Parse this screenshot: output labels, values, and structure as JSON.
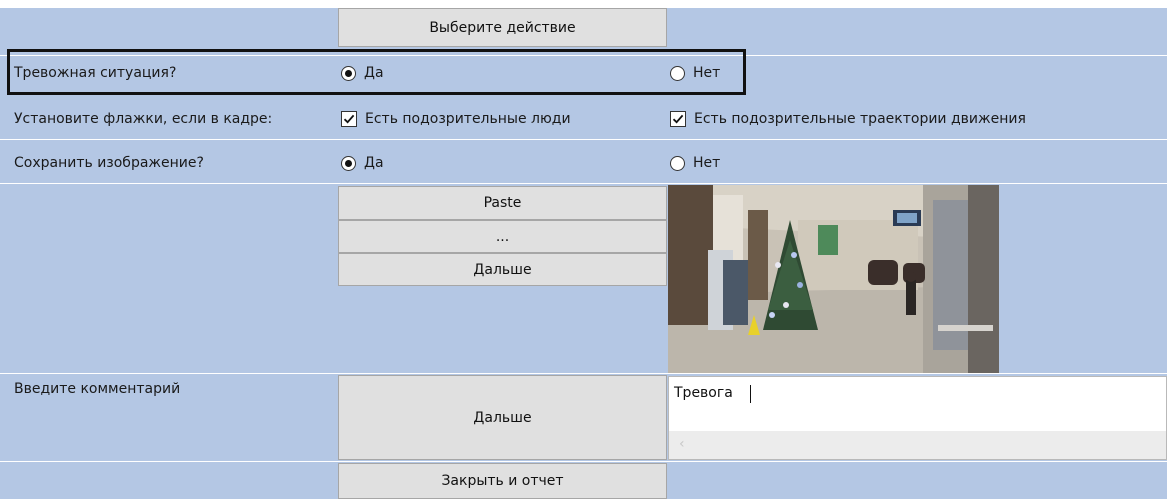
{
  "form": {
    "select_action_label": "Выберите действие",
    "q_alarm": {
      "label": "Тревожная ситуация?",
      "options": [
        {
          "label": "Да",
          "checked": true
        },
        {
          "label": "Нет",
          "checked": false
        }
      ]
    },
    "q_flags": {
      "label": "Установите флажки, если в кадре:",
      "options": [
        {
          "label": "Есть подозрительные люди",
          "checked": true
        },
        {
          "label": "Есть подозрительные траектории движения",
          "checked": true
        }
      ]
    },
    "q_save_image": {
      "label": "Сохранить изображение?",
      "options": [
        {
          "label": "Да",
          "checked": true
        },
        {
          "label": "Нет",
          "checked": false
        }
      ]
    },
    "image_buttons": {
      "paste": "Paste",
      "browse": "...",
      "next": "Дальше"
    },
    "comment": {
      "label": "Введите комментарий",
      "next_button": "Дальше",
      "value": "Тревога"
    },
    "close_report_button": "Закрыть и отчет"
  },
  "colors": {
    "background": "#b4c7e4",
    "button": "#e0e0e0",
    "highlight_border": "#111111"
  },
  "icons": {
    "radio_selected": "radio-selected-icon",
    "radio_unselected": "radio-unselected-icon",
    "checkbox_checked": "checkbox-checked-icon",
    "scroll_left": "chevron-left-icon"
  }
}
